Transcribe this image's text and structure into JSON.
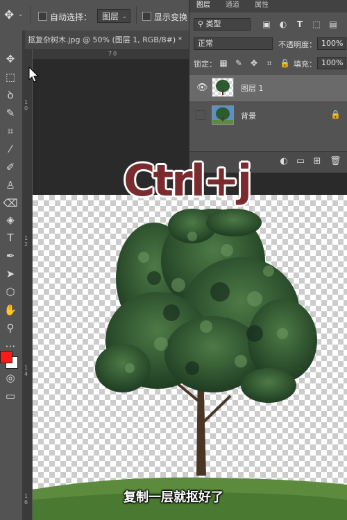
{
  "options_bar": {
    "move_icon": "move-icon",
    "auto_select_label": "自动选择：",
    "auto_select_target": "图层",
    "show_transform_label": "显示变换"
  },
  "document": {
    "tab_label": "抠复杂树木.jpg @ 50% (图层 1, RGB/8#) *",
    "close_glyph": "×"
  },
  "ruler": {
    "top_marks": [
      "7",
      "0"
    ],
    "left_marks": [
      "1",
      "0",
      "1",
      "2",
      "1",
      "4",
      "1",
      "6"
    ]
  },
  "tools": [
    {
      "name": "move-tool-icon",
      "glyph": "✥"
    },
    {
      "name": "marquee-tool-icon",
      "glyph": "⬚"
    },
    {
      "name": "lasso-tool-icon",
      "glyph": "ꝺ"
    },
    {
      "name": "quick-select-tool-icon",
      "glyph": "✎"
    },
    {
      "name": "crop-tool-icon",
      "glyph": "⌗"
    },
    {
      "name": "eyedropper-tool-icon",
      "glyph": "⁄"
    },
    {
      "name": "brush-tool-icon",
      "glyph": "✐"
    },
    {
      "name": "stamp-tool-icon",
      "glyph": "♙"
    },
    {
      "name": "eraser-tool-icon",
      "glyph": "⌫"
    },
    {
      "name": "paint-bucket-tool-icon",
      "glyph": "◈"
    },
    {
      "name": "type-tool-icon",
      "glyph": "T"
    },
    {
      "name": "pen-tool-icon",
      "glyph": "✒"
    },
    {
      "name": "path-select-tool-icon",
      "glyph": "➤"
    },
    {
      "name": "shape-tool-icon",
      "glyph": "⬡"
    },
    {
      "name": "hand-tool-icon",
      "glyph": "✋"
    },
    {
      "name": "zoom-tool-icon",
      "glyph": "⚲"
    },
    {
      "name": "more-tools-icon",
      "glyph": "⋯"
    }
  ],
  "colors": {
    "foreground": "#ff1a1a",
    "background": "#ffffff",
    "title_red": "#7a2b2d"
  },
  "layers_panel": {
    "tabs": [
      "图层",
      "通道",
      "属性"
    ],
    "filter_label": "类型",
    "blend_mode": "正常",
    "opacity_label": "不透明度：",
    "opacity_value": "100%",
    "lock_label": "锁定：",
    "fill_label": "填充：",
    "fill_value": "100%",
    "layers": [
      {
        "name": "图层 1",
        "visible": true,
        "selected": true
      },
      {
        "name": "背景",
        "visible": false,
        "locked": true
      }
    ]
  },
  "overlay": {
    "shortcut": "Ctrl+j",
    "subtitle": "复制一层就抠好了"
  }
}
